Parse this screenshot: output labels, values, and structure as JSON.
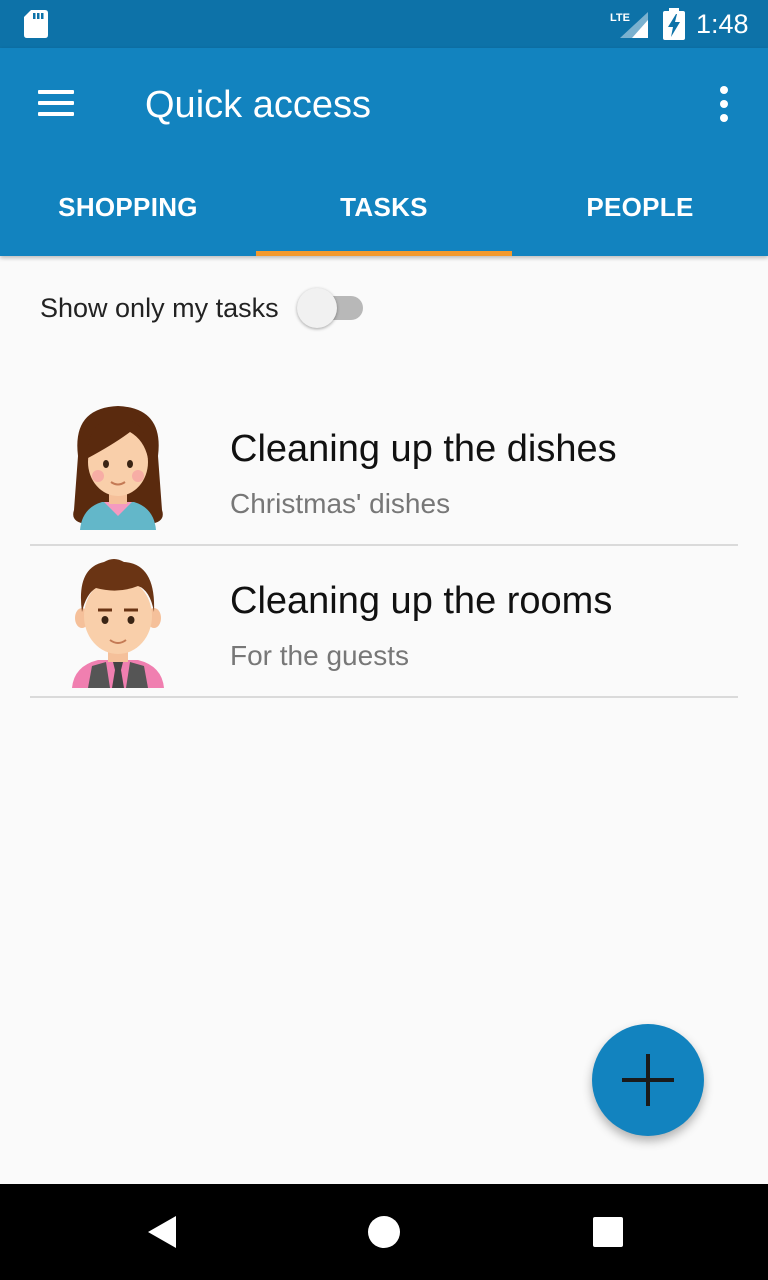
{
  "status_bar": {
    "network": "LTE",
    "time": "1:48",
    "icons": [
      "sd-card-icon",
      "lte-signal-icon",
      "battery-charging-icon"
    ]
  },
  "app_bar": {
    "title": "Quick access",
    "menu_icon": "menu-icon",
    "overflow_icon": "more-vert-icon"
  },
  "tabs": [
    {
      "label": "SHOPPING",
      "active": false
    },
    {
      "label": "TASKS",
      "active": true
    },
    {
      "label": "PEOPLE",
      "active": false
    }
  ],
  "filter": {
    "label": "Show only my tasks",
    "toggle_on": false
  },
  "tasks": [
    {
      "title": "Cleaning up the dishes",
      "subtitle": "Christmas' dishes",
      "avatar": "woman-avatar"
    },
    {
      "title": "Cleaning up the rooms",
      "subtitle": "For the guests",
      "avatar": "man-avatar"
    }
  ],
  "fab": {
    "icon": "add-icon"
  },
  "nav_bar": {
    "icons": [
      "back-icon",
      "home-icon",
      "recents-icon"
    ]
  },
  "colors": {
    "primary": "#1283bf",
    "primary_dark": "#0d72a8",
    "accent": "#f39a2e",
    "background": "#fafafa"
  }
}
